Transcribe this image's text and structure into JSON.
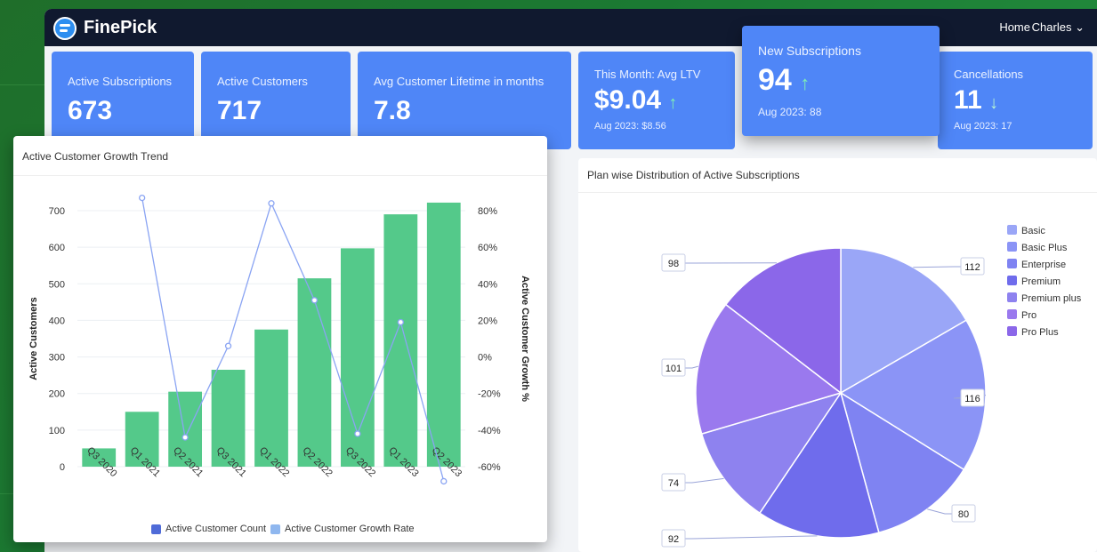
{
  "brand": {
    "name": "FinePick"
  },
  "nav": {
    "home": "Home",
    "user": "Charles",
    "user_chevron": "⌄"
  },
  "kpis": {
    "active_subscriptions": {
      "label": "Active Subscriptions",
      "value": "673"
    },
    "active_customers": {
      "label": "Active Customers",
      "value": "717"
    },
    "avg_lifetime": {
      "label": "Avg Customer Lifetime in months",
      "value": "7.8"
    },
    "ltv": {
      "label": "This Month: Avg LTV",
      "value": "$9.04",
      "arrow": "↑",
      "sub": "Aug 2023: $8.56"
    },
    "new_subs": {
      "label": "New Subscriptions",
      "value": "94",
      "arrow": "↑",
      "sub": "Aug 2023: 88"
    },
    "cancellations": {
      "label": "Cancellations",
      "value": "11",
      "arrow": "↓",
      "sub": "Aug 2023: 17"
    }
  },
  "colors": {
    "bar": "#54c98a",
    "line": "#8aa4f3",
    "kpi": "#4f86f7",
    "topbar": "#10192f"
  },
  "growth_chart": {
    "title": "Active Customer Growth Trend",
    "legend": {
      "count": "Active Customer Count",
      "rate": "Active Customer Growth Rate"
    }
  },
  "plan_chart": {
    "title": "Plan wise Distribution of Active Subscriptions"
  },
  "chart_data": [
    {
      "type": "bar",
      "title": "Active Customer Growth Trend",
      "categories": [
        "Q3 2020",
        "Q1 2021",
        "Q2 2021",
        "Q3 2021",
        "Q1 2022",
        "Q2 2022",
        "Q3 2022",
        "Q1 2023",
        "Q2 2023"
      ],
      "series": [
        {
          "name": "Active Customer Count",
          "type": "bar",
          "axis": "left",
          "values": [
            50,
            150,
            205,
            265,
            375,
            515,
            597,
            690,
            722
          ]
        },
        {
          "name": "Active Customer Growth Rate",
          "type": "line",
          "axis": "right",
          "values": [
            null,
            87,
            -44,
            6,
            84,
            31,
            -42,
            19,
            -68
          ]
        }
      ],
      "ylabel": "Active Customers",
      "ylabel_right": "Active Customer Growth %",
      "ylim": [
        0,
        700
      ],
      "yticks": [
        "0",
        "100",
        "200",
        "300",
        "400",
        "500",
        "600",
        "700"
      ],
      "ylim_right": [
        -60,
        80
      ],
      "yticks_right": [
        "-60%",
        "-40%",
        "-20%",
        "0%",
        "20%",
        "40%",
        "60%",
        "80%"
      ],
      "legend_position": "bottom"
    },
    {
      "type": "pie",
      "title": "Plan wise Distribution of Active Subscriptions",
      "labels": [
        "Basic",
        "Basic Plus",
        "Enterprise",
        "Premium",
        "Premium plus",
        "Pro",
        "Pro Plus"
      ],
      "values": [
        112,
        116,
        80,
        92,
        74,
        101,
        98
      ],
      "colors": [
        "#9aa6f7",
        "#8b94f6",
        "#7f83f2",
        "#6f6cec",
        "#8e82ef",
        "#9a79ee",
        "#8b67e9"
      ],
      "legend_position": "right"
    }
  ]
}
